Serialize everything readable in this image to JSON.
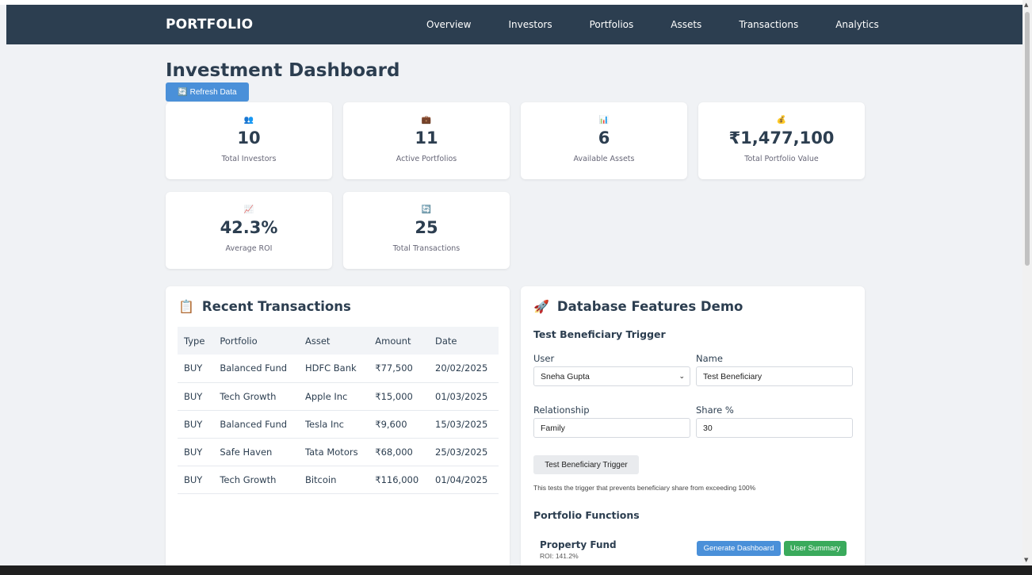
{
  "nav": {
    "brand": "PORTFOLIO",
    "links": [
      "Overview",
      "Investors",
      "Portfolios",
      "Assets",
      "Transactions",
      "Analytics"
    ]
  },
  "page": {
    "title": "Investment Dashboard",
    "refresh_label": "🔄 Refresh Data"
  },
  "stats": [
    {
      "icon": "👥",
      "value": "10",
      "label": "Total Investors"
    },
    {
      "icon": "💼",
      "value": "11",
      "label": "Active Portfolios"
    },
    {
      "icon": "📊",
      "value": "6",
      "label": "Available Assets"
    },
    {
      "icon": "💰",
      "value": "₹1,477,100",
      "label": "Total Portfolio Value"
    },
    {
      "icon": "📈",
      "value": "42.3%",
      "label": "Average ROI"
    },
    {
      "icon": "🔄",
      "value": "25",
      "label": "Total Transactions"
    }
  ],
  "transactions": {
    "icon": "📋",
    "title": "Recent Transactions",
    "headers": [
      "Type",
      "Portfolio",
      "Asset",
      "Amount",
      "Date"
    ],
    "rows": [
      [
        "BUY",
        "Balanced Fund",
        "HDFC Bank",
        "₹77,500",
        "20/02/2025"
      ],
      [
        "BUY",
        "Tech Growth",
        "Apple Inc",
        "₹15,000",
        "01/03/2025"
      ],
      [
        "BUY",
        "Balanced Fund",
        "Tesla Inc",
        "₹9,600",
        "15/03/2025"
      ],
      [
        "BUY",
        "Safe Haven",
        "Tata Motors",
        "₹68,000",
        "25/03/2025"
      ],
      [
        "BUY",
        "Tech Growth",
        "Bitcoin",
        "₹116,000",
        "01/04/2025"
      ]
    ]
  },
  "demo": {
    "icon": "🚀",
    "title": "Database Features Demo",
    "trigger_title": "Test Beneficiary Trigger",
    "user_label": "User",
    "user_value": "Sneha Gupta",
    "name_label": "Name",
    "name_value": "Test Beneficiary",
    "relationship_label": "Relationship",
    "relationship_value": "Family",
    "share_label": "Share %",
    "share_value": "30",
    "trigger_button": "Test Beneficiary Trigger",
    "trigger_note": "This tests the trigger that prevents beneficiary share from exceeding 100%",
    "functions_title": "Portfolio Functions",
    "portfolio_name": "Property Fund",
    "portfolio_roi": "ROI: 141.2%",
    "generate_label": "Generate Dashboard",
    "summary_label": "User Summary"
  },
  "colors": {
    "navbar": "#2c3e50",
    "primary": "#4a90d9",
    "success": "#3aaa5c",
    "background": "#f0f2f5"
  }
}
